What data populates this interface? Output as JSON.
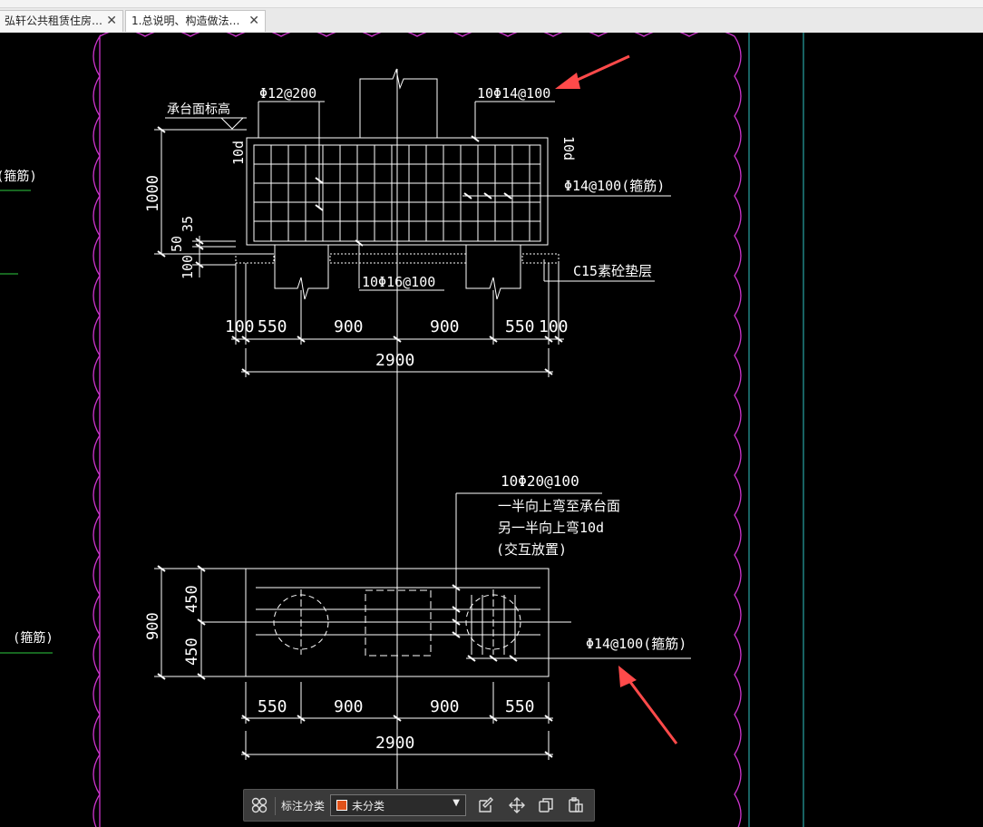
{
  "colors": {
    "background": "#000000",
    "drawing_lines": "#ffffff",
    "cloud_border": "#cc33cc",
    "frame_line": "#2fc4c4",
    "annotation_arrow": "#ff4a4a",
    "green_underline": "#2ecc40",
    "category_swatch": "#e0521a"
  },
  "tabs": [
    {
      "label": "弘轩公共租赁住房…",
      "close": "✕"
    },
    {
      "label": "1.总说明、构造做法…",
      "close": "✕"
    }
  ],
  "left_labels": {
    "rebar1": "(箍筋)",
    "rebar2": "(箍筋)"
  },
  "section": {
    "top_rebar": "Φ12@200",
    "top_right_rebar": "10Φ14@100",
    "cap_level": "承台面标高",
    "anchor_left": "10d",
    "anchor_right": "10d",
    "stirrup": "Φ14@100(箍筋)",
    "height": "1000",
    "dim_35": "35",
    "dim_50": "50",
    "dim_100": "100",
    "bottom_rebar": "10Φ16@100",
    "bedding": "C15素砼垫层",
    "dims": [
      "100",
      "550",
      "900",
      "900",
      "550",
      "100"
    ],
    "total": "2900"
  },
  "plan": {
    "rebar_note_1": "10Φ20@100",
    "rebar_note_2": "一半向上弯至承台面",
    "rebar_note_3": "另一半向上弯10d",
    "rebar_note_4": "(交互放置)",
    "stirrup": "Φ14@100(箍筋)",
    "width": "900",
    "half_top": "450",
    "half_bottom": "450",
    "dims": [
      "550",
      "900",
      "900",
      "550"
    ],
    "total": "2900"
  },
  "toolbar": {
    "grid_icon": "apps-icon",
    "label": "标注分类",
    "category": "未分类",
    "dropdown": "▼",
    "edit_icon": "edit-icon",
    "move_icon": "move-icon",
    "copy_icon": "copy-icon",
    "paste_icon": "paste-icon"
  }
}
